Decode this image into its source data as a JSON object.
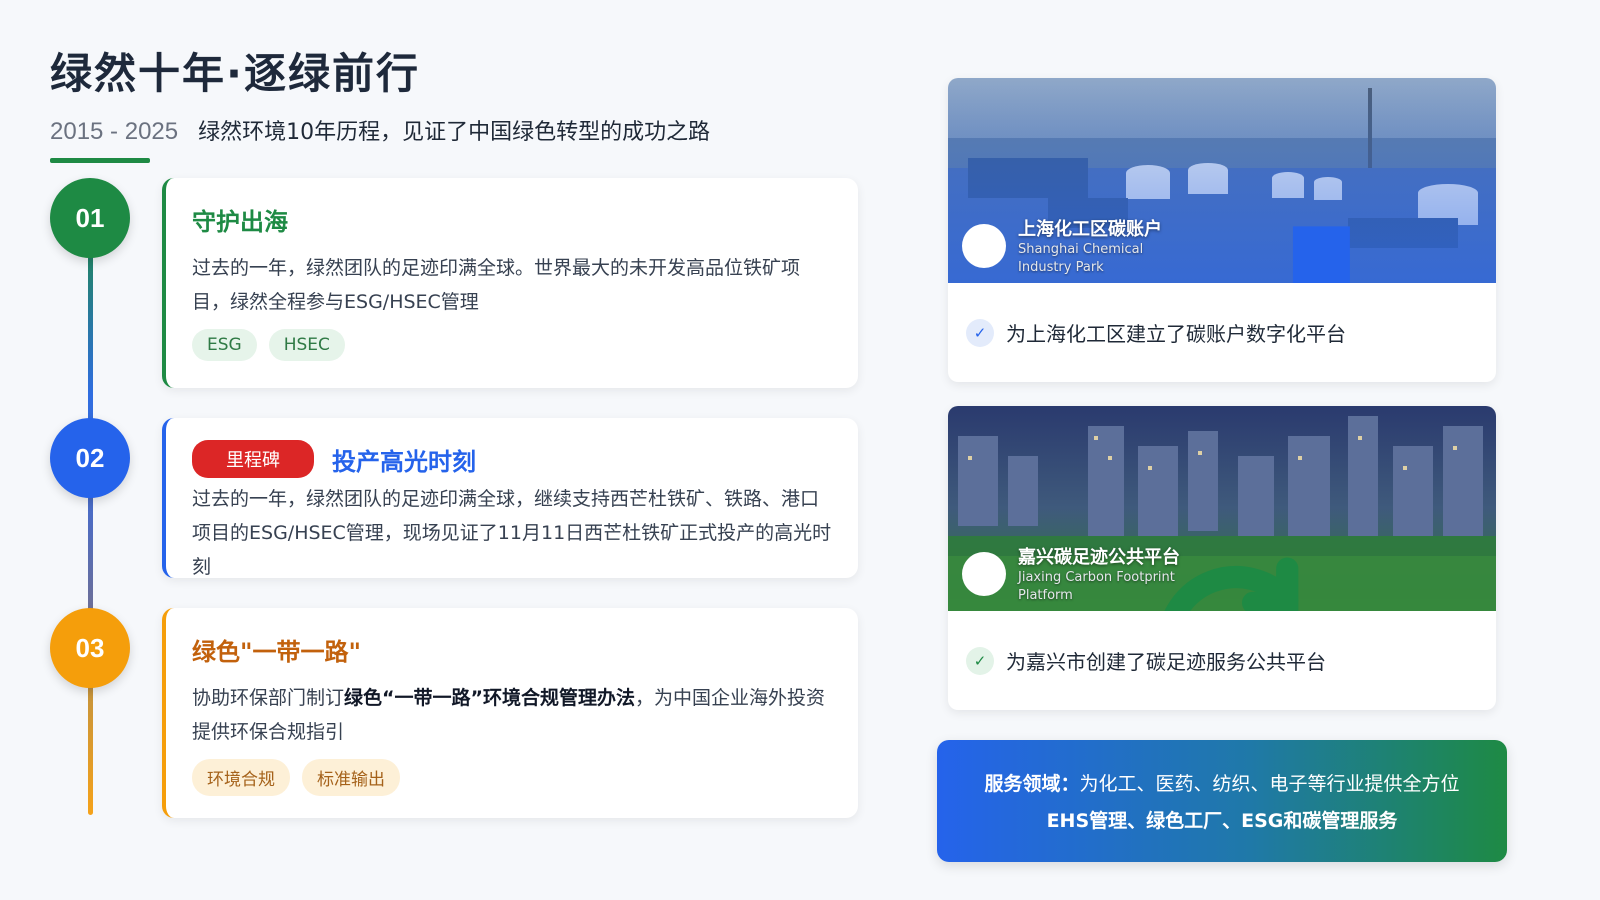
{
  "header": {
    "title": "绿然十年·逐绿前行",
    "years": "2015 - 2025",
    "subtitle": "绿然环境10年历程，见证了中国绿色转型的成功之路"
  },
  "timeline": [
    {
      "number": "01",
      "title": "守护出海",
      "text": "过去的一年，绿然团队的足迹印满全球。世界最大的未开发高品位铁矿项目，绿然全程参与ESG/HSEC管理",
      "tags": [
        "ESG",
        "HSEC"
      ],
      "accent": "#1e8a44"
    },
    {
      "number": "02",
      "badge": "里程碑",
      "title": "投产高光时刻",
      "text": "过去的一年，绿然团队的足迹印满全球，继续支持西芒杜铁矿、铁路、港口项目的ESG/HSEC管理，现场见证了11月11日西芒杜铁矿正式投产的高光时刻",
      "accent": "#2563eb"
    },
    {
      "number": "03",
      "title": "绿色\"一带一路\"",
      "text_prefix": "协助环保部门制订",
      "text_bold": "绿色“一带一路”环境合规管理办法",
      "text_suffix": "，为中国企业海外投资提供环保合规指引",
      "tags": [
        "环境合规",
        "标准输出"
      ],
      "accent": "#f59e0b"
    }
  ],
  "projects": [
    {
      "name": "上海化工区碳账户",
      "name_en": "Shanghai Chemical Industry Park",
      "icon": "factory-icon",
      "caption": "为上海化工区建立了碳账户数字化平台"
    },
    {
      "name": "嘉兴碳足迹公共平台",
      "name_en": "Jiaxing Carbon Footprint Platform",
      "icon": "refresh-icon",
      "caption": "为嘉兴市创建了碳足迹服务公共平台"
    }
  ],
  "service": {
    "label": "服务领域：",
    "line1": "为化工、医药、纺织、电子等行业提供全方位",
    "line2": "EHS管理、绿色工厂、ESG和碳管理服务"
  }
}
